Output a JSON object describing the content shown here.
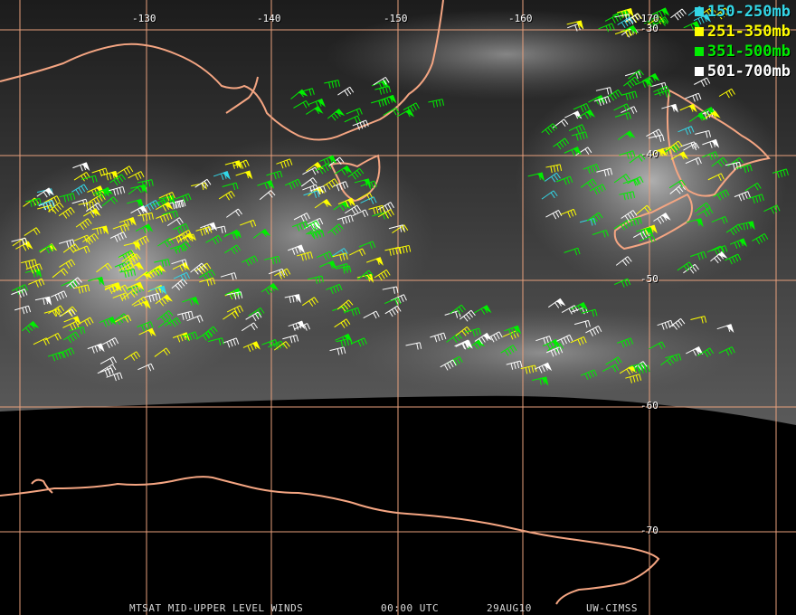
{
  "map": {
    "longitude_labels": [
      "-130",
      "-140",
      "-150",
      "-160",
      "-170"
    ],
    "latitude_labels": [
      "-30",
      "-40",
      "-50",
      "-60",
      "-70"
    ],
    "colors": {
      "grid": "#e8a07c",
      "coastline": "#f4a582",
      "cloud_sky": "#2a2a2a",
      "night_space": "#000000"
    },
    "wind_barb_layers": [
      "150-250mb",
      "251-350mb",
      "351-500mb",
      "501-700mb"
    ]
  },
  "legend": [
    {
      "label": "150-250mb",
      "color": "#33d6e6"
    },
    {
      "label": "251-350mb",
      "color": "#ffff00"
    },
    {
      "label": "351-500mb",
      "color": "#00ee00"
    },
    {
      "label": "501-700mb",
      "color": "#ffffff"
    }
  ],
  "footer": {
    "product": "MTSAT MID-UPPER LEVEL WINDS",
    "time": "00:00 UTC",
    "date": "29AUG10",
    "source": "UW-CIMSS"
  }
}
